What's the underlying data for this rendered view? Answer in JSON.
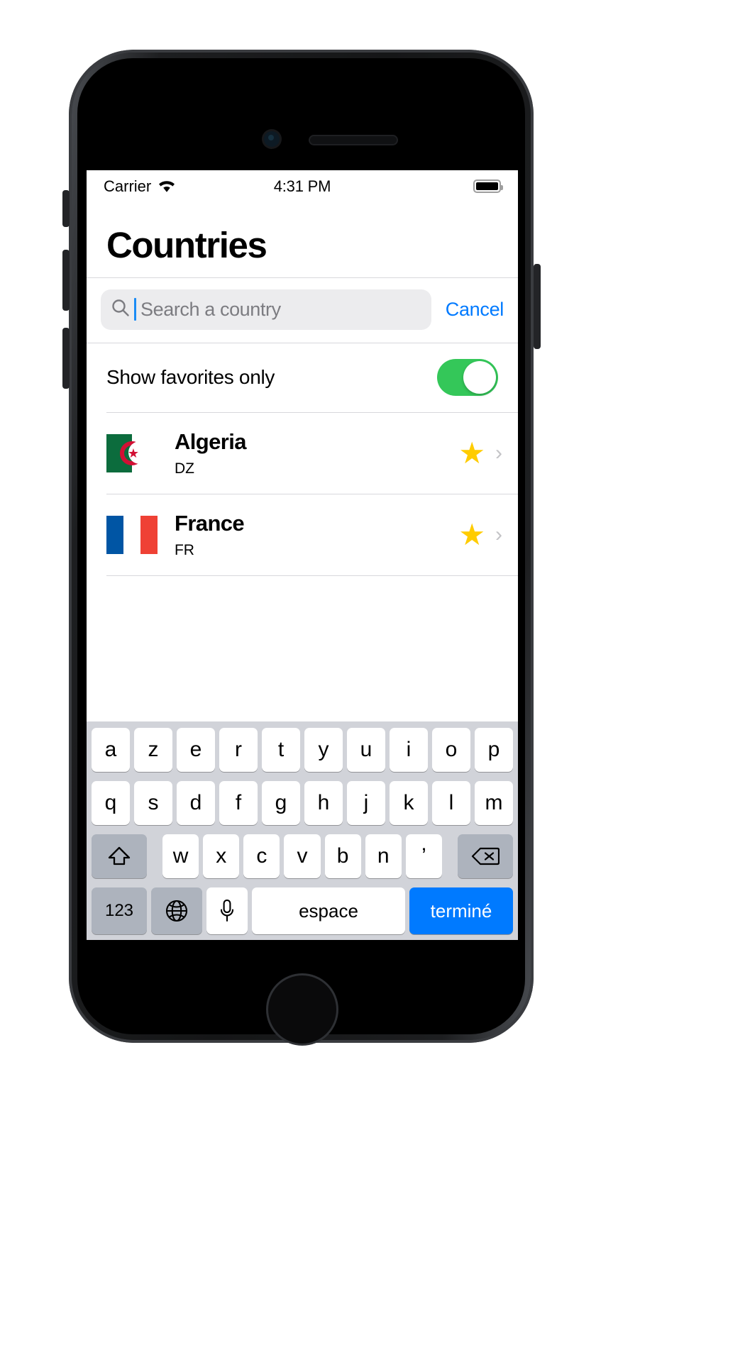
{
  "status_bar": {
    "carrier": "Carrier",
    "wifi_icon": "wifi-icon",
    "time": "4:31 PM",
    "battery_icon": "battery-full-icon",
    "battery_level_pct": 100
  },
  "nav": {
    "title": "Countries"
  },
  "search": {
    "icon": "search-icon",
    "placeholder": "Search a country",
    "value": "",
    "cancel_label": "Cancel",
    "accent_color": "#007aff",
    "field_background": "#ececee"
  },
  "favorites_toggle": {
    "label": "Show favorites only",
    "state": "on",
    "on_color": "#34c759"
  },
  "countries": [
    {
      "flag": "flag-algeria",
      "name": "Algeria",
      "code": "DZ",
      "favorite_icon": "star-filled-icon",
      "favorite": true,
      "chevron_icon": "chevron-right-icon"
    },
    {
      "flag": "flag-france",
      "name": "France",
      "code": "FR",
      "favorite_icon": "star-filled-icon",
      "favorite": true,
      "chevron_icon": "chevron-right-icon"
    }
  ],
  "keyboard": {
    "layout": "AZERTY",
    "row1": [
      "a",
      "z",
      "e",
      "r",
      "t",
      "y",
      "u",
      "i",
      "o",
      "p"
    ],
    "row2": [
      "q",
      "s",
      "d",
      "f",
      "g",
      "h",
      "j",
      "k",
      "l",
      "m"
    ],
    "row3": {
      "shift_icon": "shift-up-arrow-icon",
      "letters": [
        "w",
        "x",
        "c",
        "v",
        "b",
        "n",
        "’"
      ],
      "backspace_icon": "backspace-delete-icon"
    },
    "bottom": {
      "numbers_label": "123",
      "globe_icon": "globe-language-icon",
      "mic_icon": "microphone-icon",
      "space_label": "espace",
      "done_label": "terminé",
      "done_color": "#007aff"
    },
    "background_color": "#d1d3d9",
    "key_color": "#ffffff",
    "modifier_key_color": "#adb3bd"
  }
}
